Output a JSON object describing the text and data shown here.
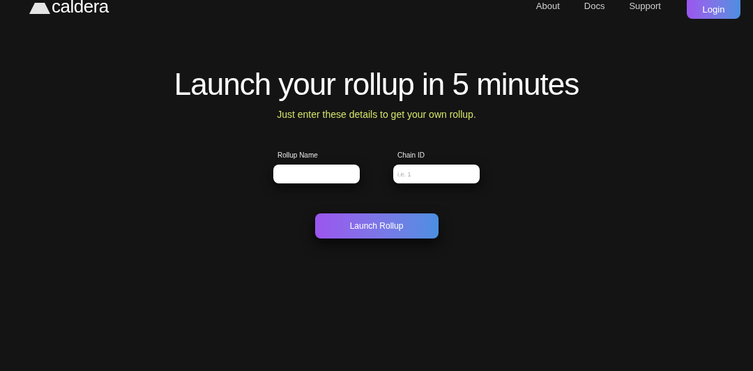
{
  "header": {
    "logo": "caldera",
    "nav": [
      "About",
      "Docs",
      "Support"
    ],
    "login": "Login"
  },
  "hero": {
    "title": "Launch your rollup in 5 minutes",
    "subtitle": "Just enter these details to get your own rollup."
  },
  "form": {
    "fields": [
      {
        "label": "Rollup Name"
      },
      {
        "label": "Chain ID",
        "placeholder": "i.e. 1"
      }
    ],
    "submit": "Launch Rollup"
  }
}
